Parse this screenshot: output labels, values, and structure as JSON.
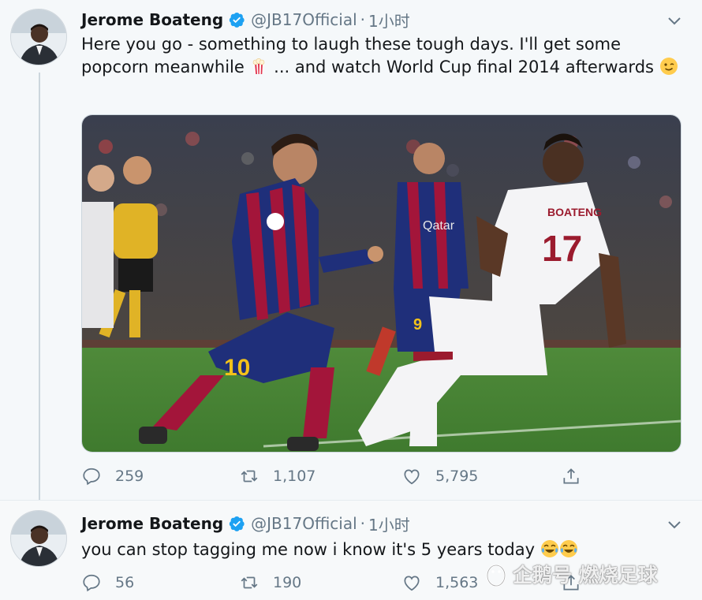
{
  "tweets": [
    {
      "author_name": "Jerome Boateng",
      "handle": "@JB17Official",
      "separator": "·",
      "time": "1小时",
      "text_part1": "Here you go - something to laugh these tough days. I'll get some popcorn meanwhile ",
      "text_part2": " ... and watch World Cup final 2014 afterwards ",
      "emojis": [
        "popcorn",
        "winking-face"
      ],
      "replies": "259",
      "retweets": "1,107",
      "likes": "5,795",
      "media": {
        "jersey_left_number": "10",
        "jersey_right_name": "BOATENG",
        "jersey_right_number": "17",
        "mid_player_number": "9",
        "mid_player_sponsor": "Qatar"
      }
    },
    {
      "author_name": "Jerome Boateng",
      "handle": "@JB17Official",
      "separator": "·",
      "time": "1小时",
      "text": "you can stop tagging me now i know it's 5 years today ",
      "emojis": [
        "face-with-tears-of-joy",
        "face-with-tears-of-joy"
      ],
      "replies": "56",
      "retweets": "190",
      "likes": "1,563"
    }
  ],
  "watermark": {
    "text": "企鹅号 燃烧足球"
  },
  "colors": {
    "background": "#f5f8fa",
    "verified": "#1da1f2",
    "secondary_text": "#657786",
    "thread_line": "#ccd6dd"
  }
}
